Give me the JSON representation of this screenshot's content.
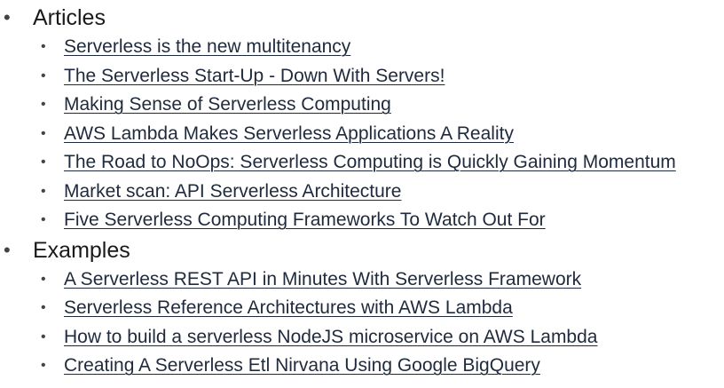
{
  "sections": [
    {
      "title": "Articles",
      "links": [
        "Serverless is the new multitenancy",
        "The Serverless Start-Up - Down With Servers!",
        "Making Sense of Serverless Computing",
        "AWS Lambda Makes Serverless Applications A Reality",
        "The Road to NoOps: Serverless Computing is Quickly Gaining Momentum",
        "Market scan: API Serverless Architecture",
        "Five Serverless Computing Frameworks To Watch Out For"
      ]
    },
    {
      "title": "Examples",
      "links": [
        "A Serverless REST API in Minutes With Serverless Framework",
        "Serverless Reference Architectures with AWS Lambda",
        "How to build a serverless NodeJS microservice on AWS Lambda",
        "Creating A Serverless Etl Nirvana Using Google BigQuery"
      ]
    }
  ]
}
